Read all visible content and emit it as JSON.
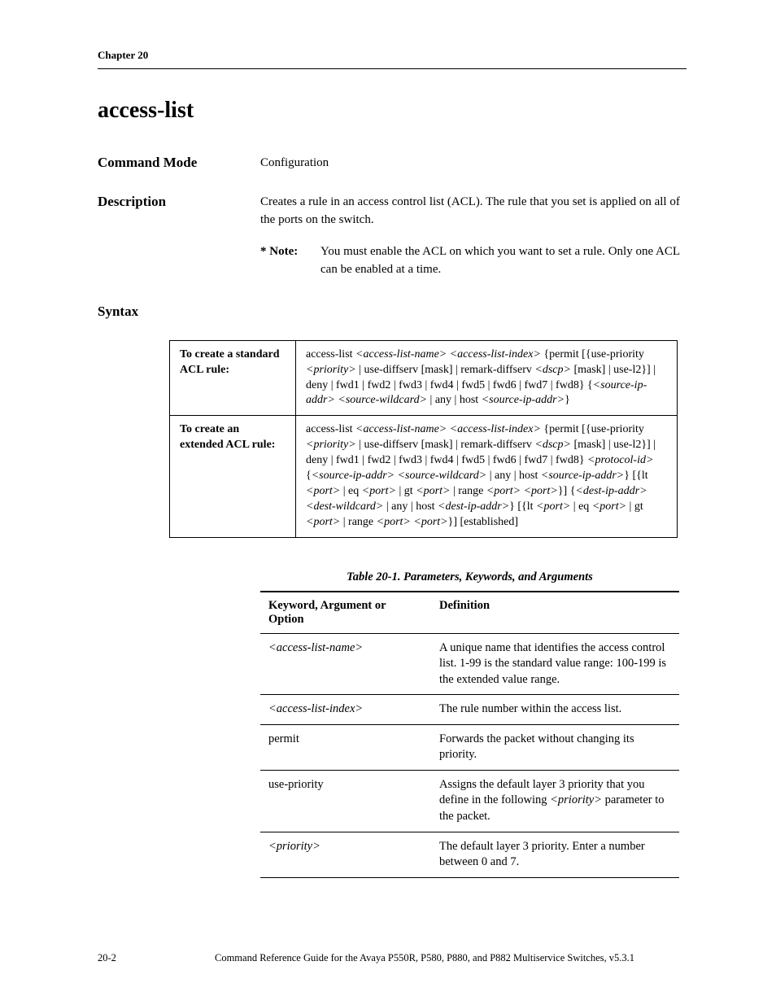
{
  "chapter_header": "Chapter 20",
  "title": "access-list",
  "command_mode": {
    "label": "Command Mode",
    "value": "Configuration"
  },
  "description": {
    "label": "Description",
    "text": "Creates a rule in an access control list (ACL). The rule that you set is applied on all of the ports on the switch.",
    "note_label": "* Note:",
    "note_text": "You must enable the ACL on which you want to set a rule. Only one ACL can be enabled at a time."
  },
  "syntax": {
    "label": "Syntax",
    "rows": [
      {
        "label": "To create a standard ACL rule:",
        "parts": [
          {
            "t": "p",
            "v": "access-list "
          },
          {
            "t": "i",
            "v": "<access-list-name> <access-list-index>"
          },
          {
            "t": "p",
            "v": " {permit [{use-priority "
          },
          {
            "t": "i",
            "v": "<priority>"
          },
          {
            "t": "p",
            "v": " | use-diffserv [mask] | remark-diffserv "
          },
          {
            "t": "i",
            "v": "<dscp>"
          },
          {
            "t": "p",
            "v": " [mask] | use-l2}] | deny | fwd1 | fwd2 | fwd3 | fwd4 | fwd5 | fwd6 | fwd7 | fwd8} {"
          },
          {
            "t": "i",
            "v": "<source-ip-addr> <source-wildcard>"
          },
          {
            "t": "p",
            "v": " | any | host "
          },
          {
            "t": "i",
            "v": "<source-ip-addr>"
          },
          {
            "t": "p",
            "v": "}"
          }
        ]
      },
      {
        "label": "To create an extended ACL rule:",
        "parts": [
          {
            "t": "p",
            "v": "access-list "
          },
          {
            "t": "i",
            "v": "<access-list-name> <access-list-index>"
          },
          {
            "t": "p",
            "v": " {permit [{use-priority "
          },
          {
            "t": "i",
            "v": "<priority>"
          },
          {
            "t": "p",
            "v": " | use-diffserv [mask] | remark-diffserv "
          },
          {
            "t": "i",
            "v": "<dscp>"
          },
          {
            "t": "p",
            "v": " [mask] | use-l2}] | deny | fwd1 | fwd2 | fwd3 | fwd4 | fwd5 | fwd6 | fwd7 | fwd8} "
          },
          {
            "t": "i",
            "v": "<protocol-id>"
          },
          {
            "t": "p",
            "v": " {"
          },
          {
            "t": "i",
            "v": "<source-ip-addr> <source-wildcard>"
          },
          {
            "t": "p",
            "v": " | any | host "
          },
          {
            "t": "i",
            "v": "<source-ip-addr>"
          },
          {
            "t": "p",
            "v": "} [{lt "
          },
          {
            "t": "i",
            "v": "<port>"
          },
          {
            "t": "p",
            "v": " | eq "
          },
          {
            "t": "i",
            "v": "<port>"
          },
          {
            "t": "p",
            "v": " | gt "
          },
          {
            "t": "i",
            "v": "<port>"
          },
          {
            "t": "p",
            "v": " | range "
          },
          {
            "t": "i",
            "v": "<port> <port>"
          },
          {
            "t": "p",
            "v": "}] {"
          },
          {
            "t": "i",
            "v": "<dest-ip-addr> <dest-wildcard>"
          },
          {
            "t": "p",
            "v": " | any | host "
          },
          {
            "t": "i",
            "v": "<dest-ip-addr>"
          },
          {
            "t": "p",
            "v": "} [{lt "
          },
          {
            "t": "i",
            "v": "<port>"
          },
          {
            "t": "p",
            "v": " | eq "
          },
          {
            "t": "i",
            "v": "<port>"
          },
          {
            "t": "p",
            "v": " | gt "
          },
          {
            "t": "i",
            "v": "<port>"
          },
          {
            "t": "p",
            "v": " | range "
          },
          {
            "t": "i",
            "v": "<port> <port>"
          },
          {
            "t": "p",
            "v": "}] [established]"
          }
        ]
      }
    ]
  },
  "param_table": {
    "caption": "Table 20-1.  Parameters, Keywords, and Arguments",
    "header_1": "Keyword, Argument or Option",
    "header_2": "Definition",
    "rows": [
      {
        "k": [
          {
            "t": "i",
            "v": "<access-list-name>"
          }
        ],
        "d": [
          {
            "t": "p",
            "v": "A unique name that identifies the access control list. 1-99 is the standard value range: 100-199 is the extended value range."
          }
        ]
      },
      {
        "k": [
          {
            "t": "i",
            "v": "<access-list-index>"
          }
        ],
        "d": [
          {
            "t": "p",
            "v": "The rule number within the access list."
          }
        ]
      },
      {
        "k": [
          {
            "t": "p",
            "v": "permit"
          }
        ],
        "d": [
          {
            "t": "p",
            "v": "Forwards the packet without changing its priority."
          }
        ]
      },
      {
        "k": [
          {
            "t": "p",
            "v": "use-priority"
          }
        ],
        "d": [
          {
            "t": "p",
            "v": "Assigns the default layer 3 priority that you define in the following "
          },
          {
            "t": "i",
            "v": "<priority>"
          },
          {
            "t": "p",
            "v": " parameter to the packet."
          }
        ]
      },
      {
        "k": [
          {
            "t": "i",
            "v": "<priority>"
          }
        ],
        "d": [
          {
            "t": "p",
            "v": "The default layer 3 priority. Enter a number between 0 and 7."
          }
        ]
      }
    ]
  },
  "footer": {
    "page": "20-2",
    "text": "Command Reference Guide for the Avaya P550R, P580, P880, and P882 Multiservice Switches, v5.3.1"
  }
}
